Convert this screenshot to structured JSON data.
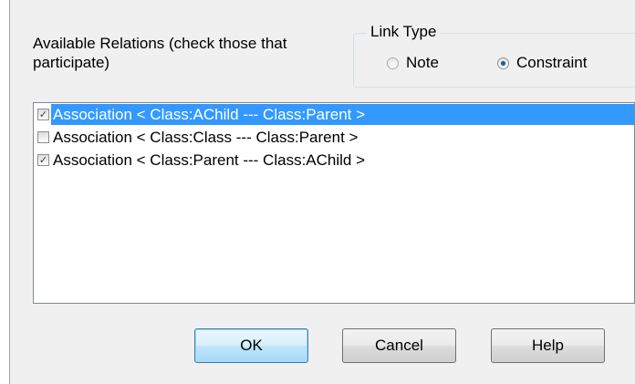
{
  "relations_label": "Available Relations (check those that participate)",
  "link_type": {
    "legend": "Link Type",
    "options": [
      {
        "label": "Note",
        "checked": false
      },
      {
        "label": "Constraint",
        "checked": true
      }
    ]
  },
  "relations": [
    {
      "label": "Association < Class:AChild --- Class:Parent >",
      "checked": true,
      "selected": true
    },
    {
      "label": "Association < Class:Class --- Class:Parent >",
      "checked": false,
      "selected": false
    },
    {
      "label": "Association < Class:Parent --- Class:AChild >",
      "checked": true,
      "selected": false
    }
  ],
  "buttons": {
    "ok": "OK",
    "cancel": "Cancel",
    "help": "Help"
  },
  "colors": {
    "dialog_bg": "#f0f0f0",
    "selection": "#3399ff",
    "default_button": "#bee6fd"
  }
}
